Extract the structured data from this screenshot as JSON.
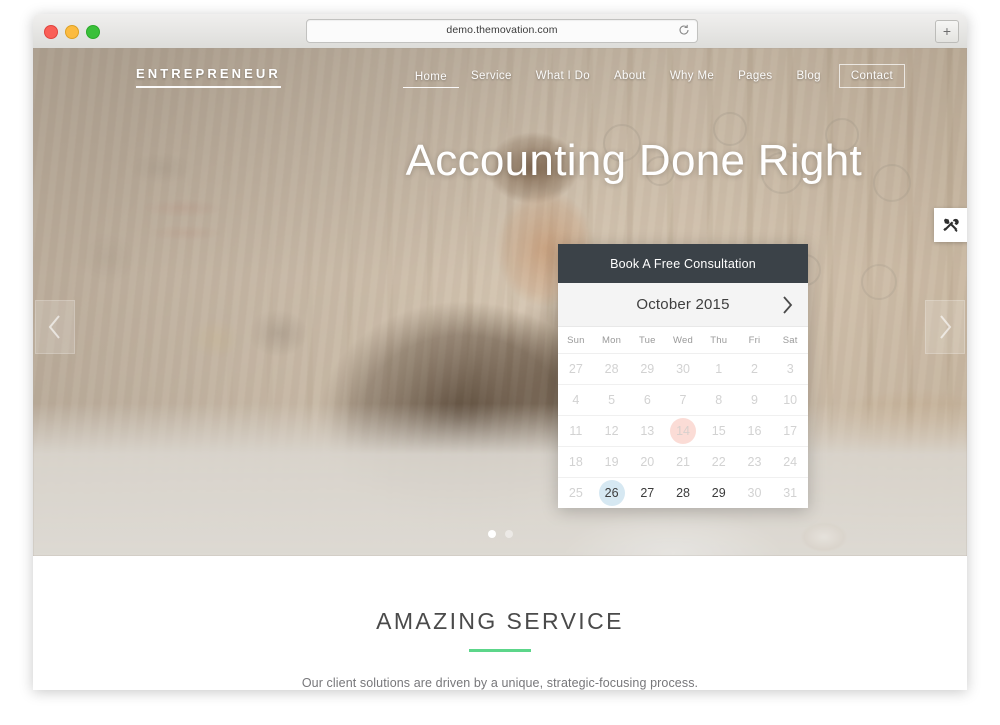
{
  "browser": {
    "url": "demo.themovation.com",
    "reload_icon": "reload-icon",
    "new_tab_label": "+",
    "traffic_lights": [
      "close",
      "minimize",
      "maximize"
    ]
  },
  "site": {
    "logo": "ENTREPRENEUR",
    "nav": [
      {
        "label": "Home",
        "state": "active"
      },
      {
        "label": "Service",
        "state": "default"
      },
      {
        "label": "What I Do",
        "state": "default"
      },
      {
        "label": "About",
        "state": "default"
      },
      {
        "label": "Why Me",
        "state": "default"
      },
      {
        "label": "Pages",
        "state": "default"
      },
      {
        "label": "Blog",
        "state": "default"
      },
      {
        "label": "Contact",
        "state": "boxed"
      }
    ]
  },
  "hero": {
    "headline": "Accounting Done Right",
    "prev_arrow_icon": "chevron-left-icon",
    "next_arrow_icon": "chevron-right-icon",
    "dots": [
      {
        "active": true
      },
      {
        "active": false
      }
    ]
  },
  "theme_options": {
    "icon": "tools-icon"
  },
  "booking": {
    "title": "Book A Free Consultation",
    "calendar": {
      "month_label": "October 2015",
      "next_icon": "chevron-right-icon",
      "weekdays": [
        "Sun",
        "Mon",
        "Tue",
        "Wed",
        "Thu",
        "Fri",
        "Sat"
      ],
      "weeks": [
        [
          {
            "day": "27",
            "state": "muted"
          },
          {
            "day": "28",
            "state": "muted"
          },
          {
            "day": "29",
            "state": "muted"
          },
          {
            "day": "30",
            "state": "muted"
          },
          {
            "day": "1",
            "state": "muted"
          },
          {
            "day": "2",
            "state": "muted"
          },
          {
            "day": "3",
            "state": "muted"
          }
        ],
        [
          {
            "day": "4",
            "state": "muted"
          },
          {
            "day": "5",
            "state": "muted"
          },
          {
            "day": "6",
            "state": "muted"
          },
          {
            "day": "7",
            "state": "muted"
          },
          {
            "day": "8",
            "state": "muted"
          },
          {
            "day": "9",
            "state": "muted"
          },
          {
            "day": "10",
            "state": "muted"
          }
        ],
        [
          {
            "day": "11",
            "state": "muted"
          },
          {
            "day": "12",
            "state": "muted"
          },
          {
            "day": "13",
            "state": "muted"
          },
          {
            "day": "14",
            "state": "today"
          },
          {
            "day": "15",
            "state": "muted"
          },
          {
            "day": "16",
            "state": "muted"
          },
          {
            "day": "17",
            "state": "muted"
          }
        ],
        [
          {
            "day": "18",
            "state": "muted"
          },
          {
            "day": "19",
            "state": "muted"
          },
          {
            "day": "20",
            "state": "muted"
          },
          {
            "day": "21",
            "state": "muted"
          },
          {
            "day": "22",
            "state": "muted"
          },
          {
            "day": "23",
            "state": "muted"
          },
          {
            "day": "24",
            "state": "muted"
          }
        ],
        [
          {
            "day": "25",
            "state": "muted"
          },
          {
            "day": "26",
            "state": "selected"
          },
          {
            "day": "27",
            "state": "available"
          },
          {
            "day": "28",
            "state": "available"
          },
          {
            "day": "29",
            "state": "available"
          },
          {
            "day": "30",
            "state": "muted"
          },
          {
            "day": "31",
            "state": "muted"
          }
        ]
      ]
    }
  },
  "service_section": {
    "heading": "AMAZING SERVICE",
    "subtitle": "Our client solutions are driven by a unique, strategic-focusing process."
  },
  "colors": {
    "accent_green": "#5cd68a",
    "dark_panel": "#3b4248",
    "today_highlight": "#fbdcd6",
    "selected_highlight": "#d6e8f2"
  }
}
